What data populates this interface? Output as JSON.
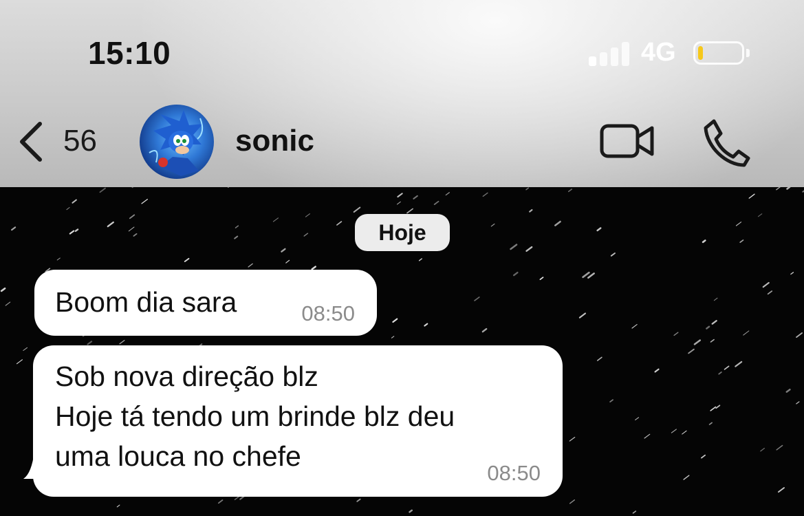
{
  "status_bar": {
    "time": "15:10",
    "network": "4G",
    "signal_bars_active": 1,
    "signal_bars_total": 4,
    "battery_level": 0.12,
    "battery_color": "#f6c81b"
  },
  "nav": {
    "back_count": "56",
    "contact_name": "sonic",
    "avatar_icon": "sonic-avatar",
    "icons": [
      "chevron-left-icon",
      "video-camera-icon",
      "phone-icon"
    ]
  },
  "chat": {
    "date_label": "Hoje",
    "messages": [
      {
        "text": "Boom dia sara",
        "time": "08:50"
      },
      {
        "text": "Sob nova direção blz\nHoje tá tendo um brinde blz deu\numa louca no chefe",
        "time": "08:50"
      }
    ]
  },
  "colors": {
    "chat_background": "#050505",
    "bubble": "#ffffff",
    "timestamp": "#8b8b8b",
    "date_pill": "#ececec"
  }
}
